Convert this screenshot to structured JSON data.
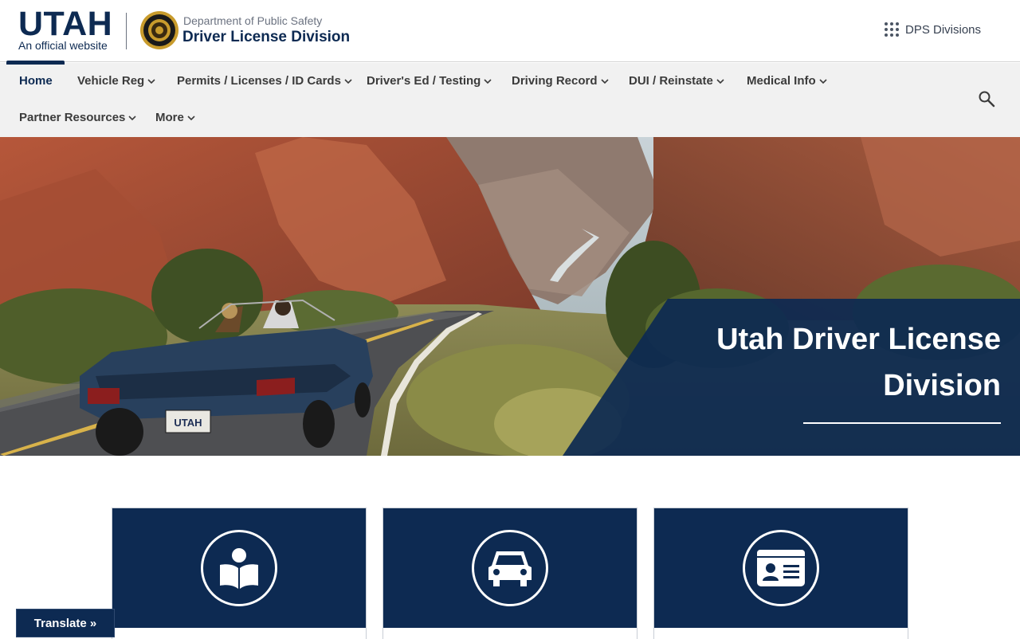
{
  "header": {
    "state_name": "UTAH",
    "official_tagline": "An official website",
    "department": "Department of Public Safety",
    "division": "Driver License Division",
    "divisions_link": "DPS Divisions"
  },
  "nav": {
    "items": [
      {
        "label": "Home"
      },
      {
        "label": "Vehicle Reg"
      },
      {
        "label": "Permits / Licenses / ID Cards"
      },
      {
        "label": "Driver's Ed / Testing"
      },
      {
        "label": "Driving Record"
      },
      {
        "label": "DUI / Reinstate"
      },
      {
        "label": "Medical Info"
      },
      {
        "label": "Partner Resources"
      },
      {
        "label": "More"
      }
    ]
  },
  "hero": {
    "title": "Utah Driver License Division",
    "plate_text": "UTAH"
  },
  "cards": [
    {
      "icon": "reader-book-icon"
    },
    {
      "icon": "car-icon"
    },
    {
      "icon": "id-card-icon"
    }
  ],
  "translate": {
    "label": "Translate »"
  },
  "colors": {
    "navy": "#0d2a52",
    "nav_bg": "#f1f1f1",
    "text_gray": "#3b3b3b"
  }
}
